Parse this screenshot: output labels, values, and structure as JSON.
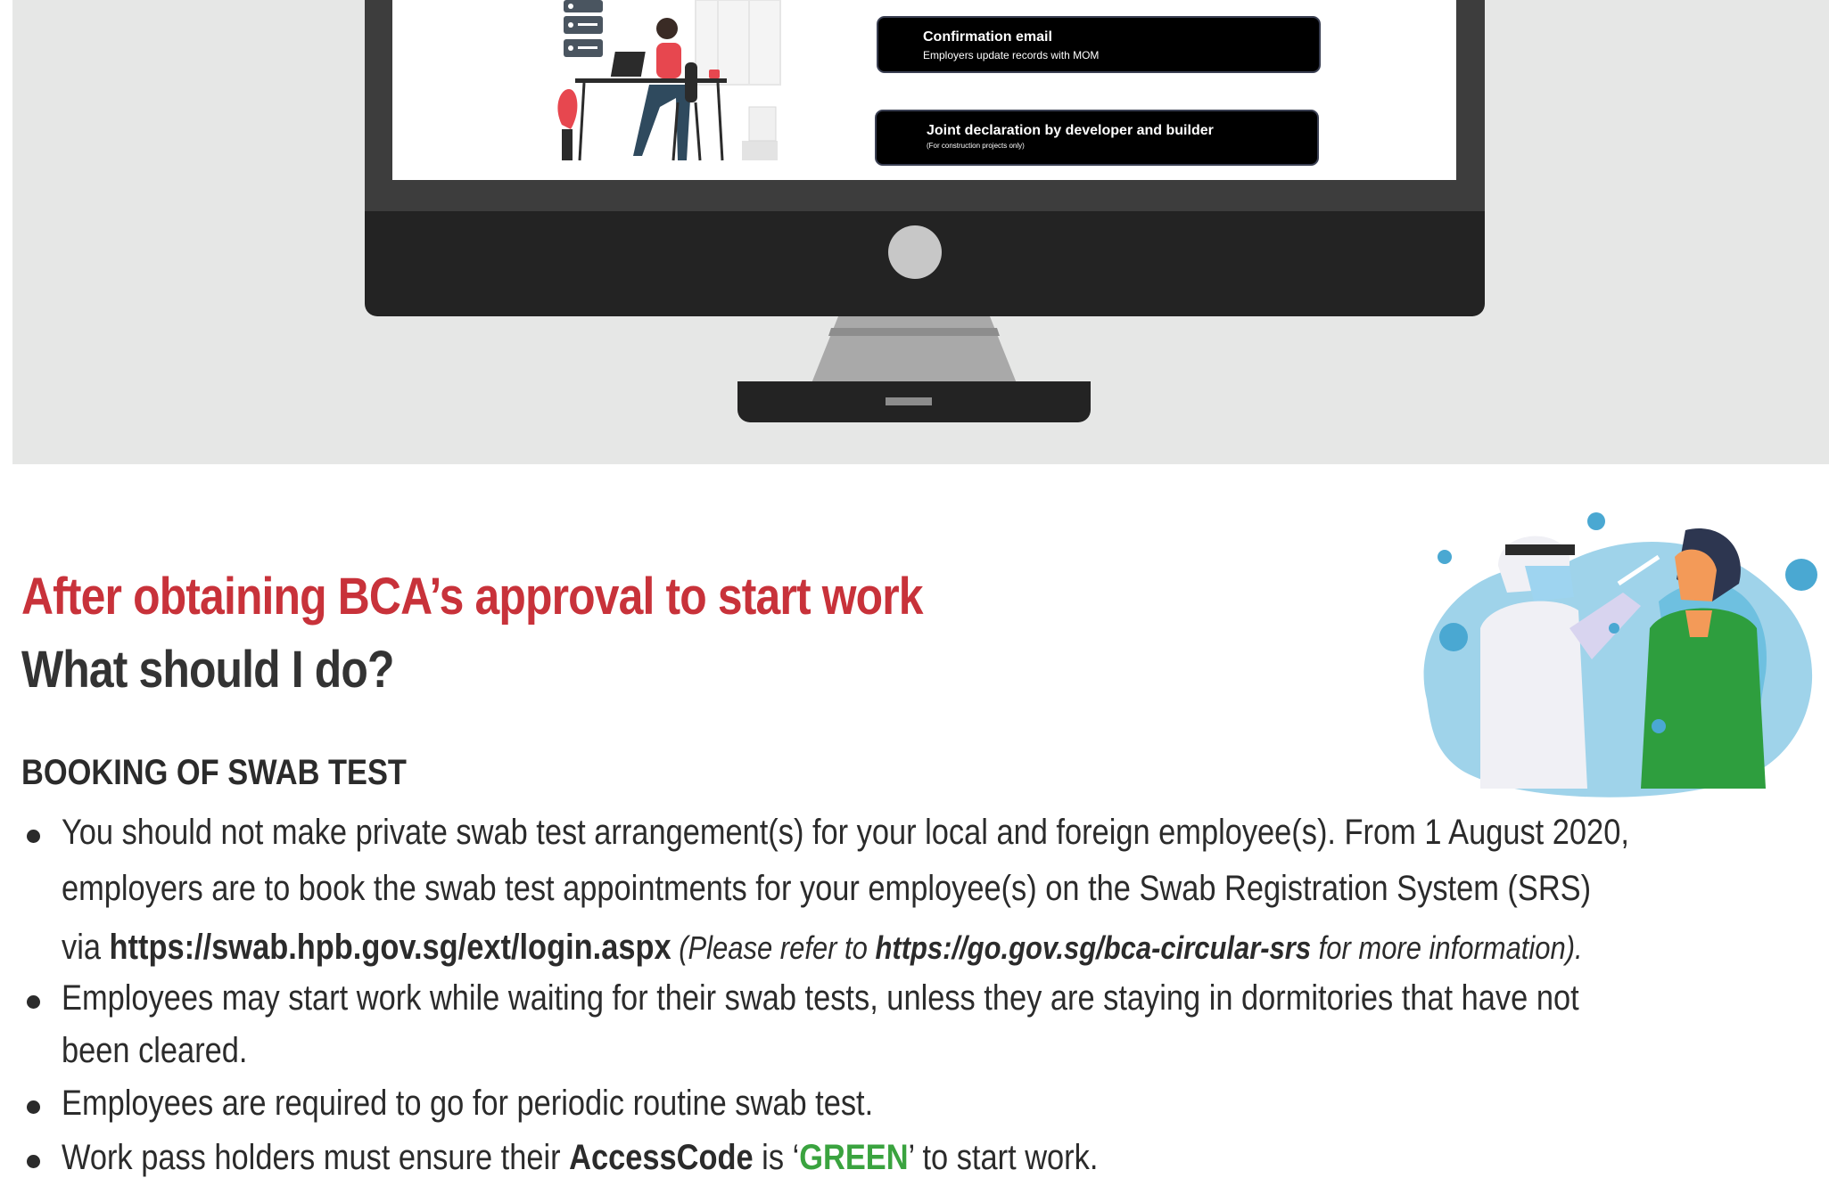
{
  "steps": {
    "confirmation_title": "Confirmation email",
    "confirmation_sub": "Employers update records with MOM",
    "joint_title": "Joint declaration by developer and builder",
    "joint_sub": "(For construction projects only)"
  },
  "heading": {
    "approval": "After obtaining BCA’s approval to start work",
    "question": "What should I do?"
  },
  "section": {
    "title": "BOOKING OF SWAB TEST"
  },
  "bullets": {
    "b1_l1": "You should not make private swab test arrangement(s) for your local and foreign employee(s). From 1 August 2020,",
    "b1_l2": "employers are to book the swab test appointments for your employee(s) on the Swab Registration System (SRS)",
    "b1_l3_pre": "via ",
    "b1_l3_url": "https://swab.hpb.gov.sg/ext/login.aspx",
    "b1_l3_note_pre": " (Please refer to ",
    "b1_l3_note_url": "https://go.gov.sg/bca-circular-srs",
    "b1_l3_note_post": " for more information).",
    "b2_l1": "Employees may start work while waiting for their swab tests, unless they are staying in dormitories that have not",
    "b2_l2": "been cleared.",
    "b3_l1": "Employees are required to go for periodic routine swab test.",
    "b4_pre": "Work pass holders must ensure their ",
    "b4_bold": "AccessCode",
    "b4_mid": " is ‘",
    "b4_green": "GREEN",
    "b4_post": "’ to start work."
  },
  "colors": {
    "accent_red": "#c8323a",
    "green": "#3aa33f",
    "panel_grey": "#e6e7e6"
  }
}
